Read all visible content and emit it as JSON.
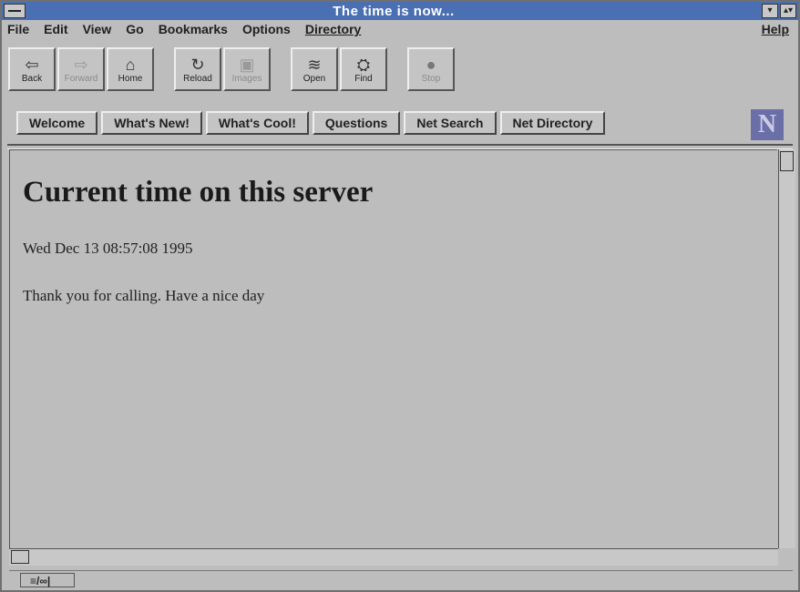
{
  "window": {
    "title": "The time is now..."
  },
  "menu": {
    "items": [
      "File",
      "Edit",
      "View",
      "Go",
      "Bookmarks",
      "Options"
    ],
    "directory": "Directory",
    "help": "Help"
  },
  "toolbar": {
    "buttons": [
      {
        "label": "Back",
        "icon": "⇦"
      },
      {
        "label": "Forward",
        "icon": "⇨"
      },
      {
        "label": "Home",
        "icon": "⌂"
      },
      {
        "label": "Reload",
        "icon": "↻"
      },
      {
        "label": "Images",
        "icon": "▣"
      },
      {
        "label": "Open",
        "icon": "≋"
      },
      {
        "label": "Find",
        "icon": "⛭"
      },
      {
        "label": "Stop",
        "icon": "●"
      }
    ]
  },
  "directory_buttons": [
    "Welcome",
    "What's New!",
    "What's Cool!",
    "Questions",
    "Net Search",
    "Net Directory"
  ],
  "logo": {
    "letter": "N"
  },
  "content": {
    "heading": "Current time on this server",
    "time": "Wed Dec 13 08:57:08 1995",
    "message": "Thank you for calling. Have a nice day"
  },
  "status": {
    "icon_text": "≡/∞|"
  }
}
